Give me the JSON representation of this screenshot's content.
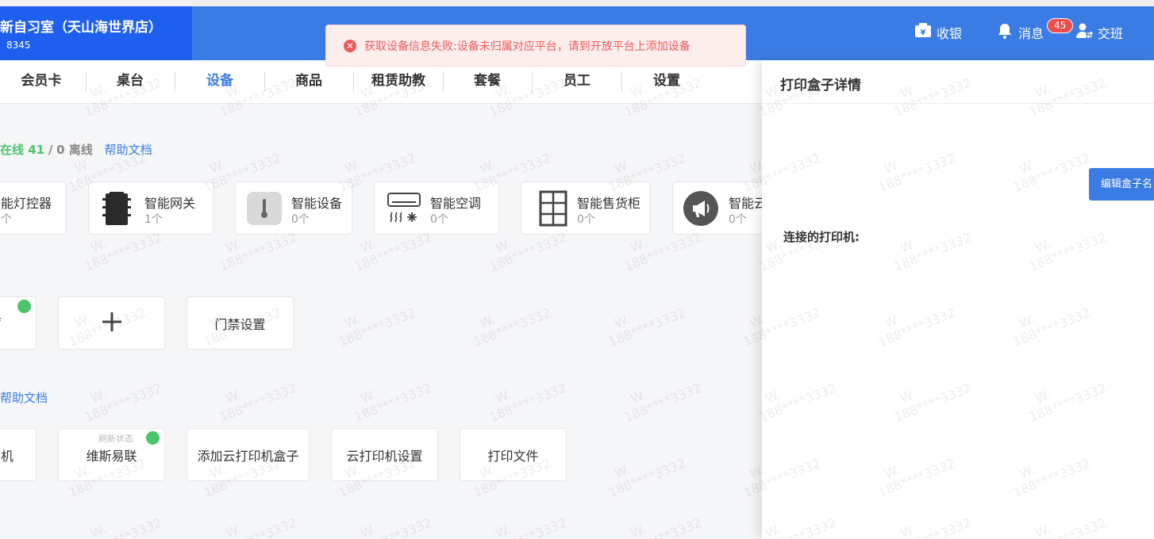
{
  "header": {
    "brand_title": "新自习室（天山海世界店）",
    "brand_sub": "8345",
    "cashier_label": "收银",
    "messages_label": "消息",
    "messages_badge": "45",
    "shift_label": "交班"
  },
  "toast": {
    "message": "获取设备信息失败:设备未归属对应平台，请到开放平台上添加设备"
  },
  "tabs": [
    "会员卡",
    "桌台",
    "设备",
    "商品",
    "租赁助教",
    "套餐",
    "员工",
    "设置"
  ],
  "active_tab": "设备",
  "status": {
    "online_text": "在线 41",
    "separator": "/",
    "offline_text": "0 离线",
    "help_label": "帮助文档"
  },
  "devices": [
    {
      "name": "能灯控器",
      "count": "个",
      "icon": "light-controller-icon"
    },
    {
      "name": "智能网关",
      "count": "1个",
      "icon": "gateway-icon"
    },
    {
      "name": "智能设备",
      "count": "0个",
      "icon": "thermometer-icon"
    },
    {
      "name": "智能空调",
      "count": "0个",
      "icon": "air-conditioner-icon"
    },
    {
      "name": "智能售货柜",
      "count": "0个",
      "icon": "vending-cabinet-icon"
    },
    {
      "name": "智能云",
      "count": "0个",
      "icon": "megaphone-icon"
    }
  ],
  "access_row": {
    "first_partial": "f",
    "door_settings": "门禁设置"
  },
  "help2": "帮助文档",
  "printer_row": {
    "first_partial": "机",
    "weisi_label": "维斯易联",
    "refresh_label": "刷新状态",
    "add_box": "添加云打印机盒子",
    "cloud_settings": "云打印机设置",
    "print_file": "打印文件"
  },
  "panel": {
    "title": "打印盒子详情",
    "edit_button": "编辑盒子名",
    "printers_label": "连接的打印机:"
  },
  "watermark": {
    "line1": "W.",
    "line2": "188****3332"
  },
  "colors": {
    "primary": "#3b7ce4",
    "brand": "#1f5ff0",
    "online": "#4cc46c",
    "error": "#f05a5a"
  }
}
